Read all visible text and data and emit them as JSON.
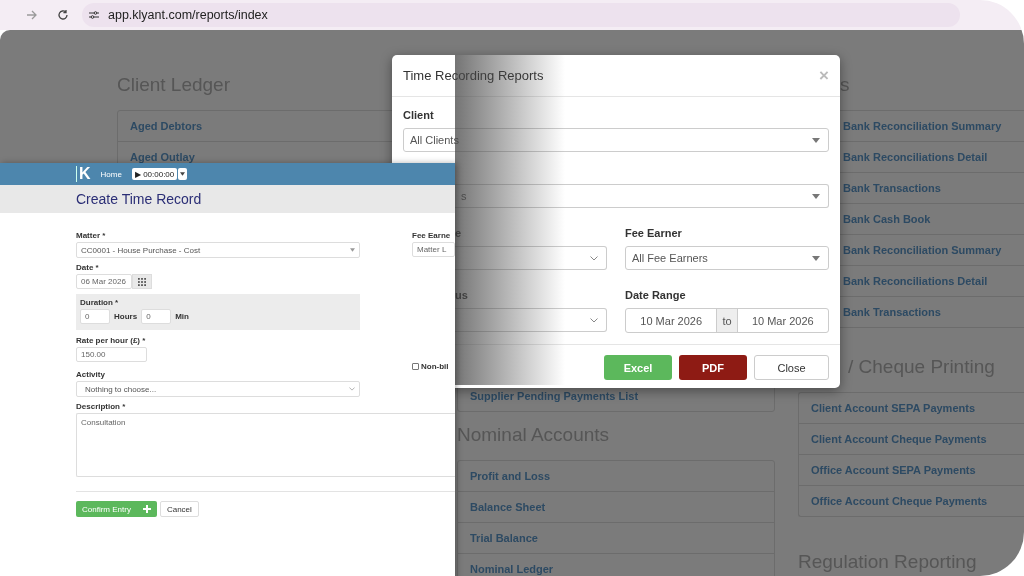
{
  "browser": {
    "url": "app.klyant.com/reports/index"
  },
  "background_page": {
    "client_ledger": {
      "heading": "Client Ledger",
      "items": [
        "Aged Debtors",
        "Aged Outlay"
      ]
    },
    "supplier": {
      "items": [
        "Supplier Pending Payments List"
      ]
    },
    "nominal_accounts": {
      "heading": "Nominal Accounts",
      "items": [
        "Profit and Loss",
        "Balance Sheet",
        "Trial Balance",
        "Nominal Ledger"
      ]
    },
    "bank": {
      "heading": "s",
      "items": [
        "Bank Reconciliation Summary",
        "Bank Reconciliations Detail",
        "Bank Transactions",
        "Bank Cash Book",
        "Bank Reconciliation Summary",
        "Bank Reconciliations Detail",
        "Bank Transactions"
      ]
    },
    "cheque_printing": {
      "heading": "/ Cheque Printing",
      "items": [
        "Client Account SEPA Payments",
        "Client Account Cheque Payments",
        "Office Account SEPA Payments",
        "Office Account Cheque Payments"
      ]
    },
    "regulation": {
      "heading": "Regulation Reporting"
    }
  },
  "modal": {
    "title": "Time Recording Reports",
    "close": "×",
    "client": {
      "label": "Client",
      "value": "All Clients"
    },
    "second": {
      "value": "s"
    },
    "row3": {
      "left_label": "e",
      "right_label": "Fee Earner",
      "right_value": "All Fee Earners"
    },
    "row4": {
      "left_label": "us",
      "right_label": "Date Range",
      "from": "10 Mar 2026",
      "to_label": "to",
      "to": "10 Mar 2026"
    },
    "buttons": [
      {
        "label": "Excel",
        "kind": "excel"
      },
      {
        "label": "PDF",
        "kind": "pdf"
      },
      {
        "label": "Close",
        "kind": "close"
      }
    ]
  },
  "time_record": {
    "logo": "K",
    "nav": {
      "home": "Home",
      "timer": "▶ 00:00:00"
    },
    "title": "Create Time Record",
    "matter": {
      "label": "Matter *",
      "value": "CC0001 - House Purchase - Cost"
    },
    "fee_earner": {
      "label": "Fee Earne",
      "value": "Matter L"
    },
    "date": {
      "label": "Date *",
      "value": "06 Mar 2026"
    },
    "duration": {
      "label": "Duration *",
      "hours": "0",
      "hours_label": "Hours",
      "min": "0",
      "min_label": "Min"
    },
    "rate": {
      "label": "Rate per hour (£) *",
      "value": "150.00"
    },
    "non_billable": {
      "label": "Non-bil",
      "checked": false
    },
    "activity": {
      "label": "Activity",
      "value": "Nothing to choose..."
    },
    "description": {
      "label": "Description *",
      "value": "Consultation"
    },
    "confirm": "Confirm Entry",
    "cancel": "Cancel"
  }
}
